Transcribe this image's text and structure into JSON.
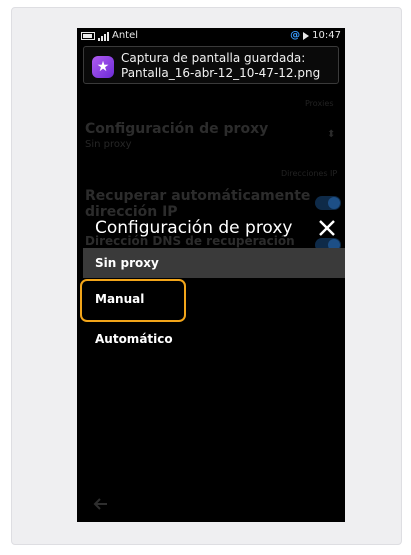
{
  "status_bar": {
    "carrier": "Antel",
    "time": "10:47",
    "icons": [
      "battery-icon",
      "signal-icon",
      "at-icon",
      "play-icon"
    ]
  },
  "notification": {
    "icon": "star-icon",
    "line1": "Captura de pantalla guardada:",
    "line2": "Pantalla_16-abr-12_10-47-12.png"
  },
  "background_settings": {
    "section1": "Proxies",
    "proxy_title": "Configuración de proxy",
    "proxy_value": "Sin proxy",
    "section2": "Direcciones IP",
    "auto_ip_title_1": "Recuperar automáticamente",
    "auto_ip_title_2": "dirección IP",
    "dns_title": "Dirección DNS de recuperación"
  },
  "dialog": {
    "title": "Configuración de proxy",
    "options": [
      {
        "label": "Sin proxy",
        "selected": true
      },
      {
        "label": "Manual",
        "selected": false
      },
      {
        "label": "Automático",
        "selected": false
      }
    ],
    "highlight_color": "#f2a51a"
  }
}
